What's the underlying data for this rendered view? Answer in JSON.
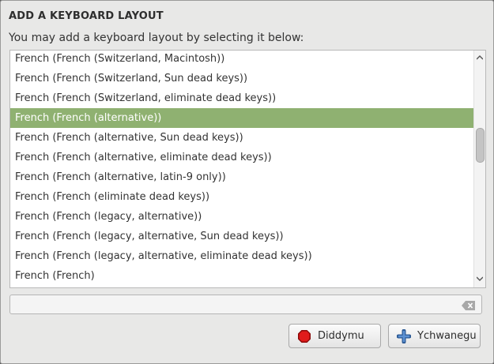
{
  "dialog": {
    "title": "ADD A KEYBOARD LAYOUT",
    "subtitle": "You may add a keyboard layout by selecting it below:"
  },
  "layouts": [
    {
      "label": "French (French (Switzerland, Macintosh))",
      "selected": false
    },
    {
      "label": "French (French (Switzerland, Sun dead keys))",
      "selected": false
    },
    {
      "label": "French (French (Switzerland, eliminate dead keys))",
      "selected": false
    },
    {
      "label": "French (French (alternative))",
      "selected": true
    },
    {
      "label": "French (French (alternative, Sun dead keys))",
      "selected": false
    },
    {
      "label": "French (French (alternative, eliminate dead keys))",
      "selected": false
    },
    {
      "label": "French (French (alternative, latin-9 only))",
      "selected": false
    },
    {
      "label": "French (French (eliminate dead keys))",
      "selected": false
    },
    {
      "label": "French (French (legacy, alternative))",
      "selected": false
    },
    {
      "label": "French (French (legacy, alternative, Sun dead keys))",
      "selected": false
    },
    {
      "label": "French (French (legacy, alternative, eliminate dead keys))",
      "selected": false
    },
    {
      "label": "French (French)",
      "selected": false
    }
  ],
  "search": {
    "value": "",
    "placeholder": ""
  },
  "buttons": {
    "cancel_label": "Diddymu",
    "add_label": "Ychwanegu"
  },
  "icons": {
    "scroll_up": "chevron-up-icon",
    "scroll_down": "chevron-down-icon",
    "clear": "clear-text-icon",
    "cancel": "stop-icon",
    "add": "plus-icon"
  },
  "colors": {
    "selection": "#8fb171",
    "cancel_icon": "#e01b1b",
    "add_icon": "#3a6fb0"
  }
}
